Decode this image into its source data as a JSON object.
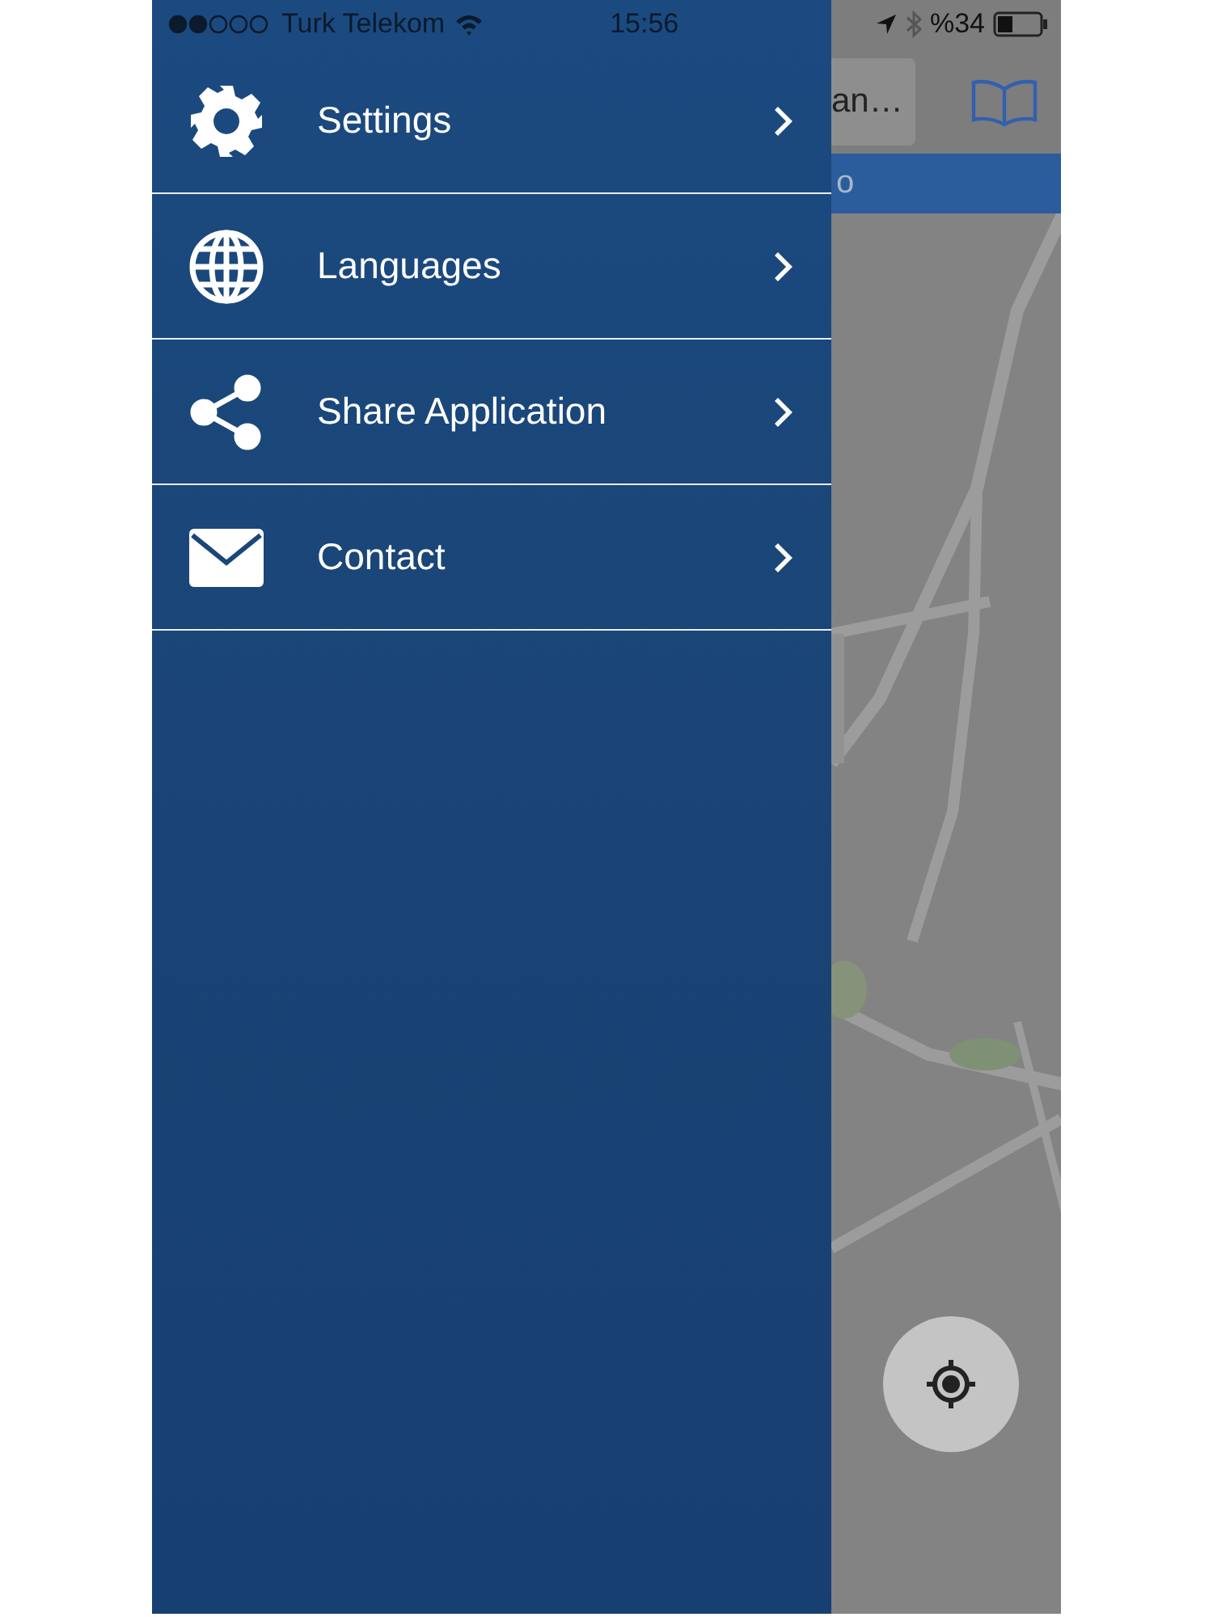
{
  "status_bar": {
    "carrier": "Turk Telekom",
    "time": "15:56",
    "battery": "%34"
  },
  "header": {
    "search_text": "an…",
    "tab_text": "o"
  },
  "menu": [
    {
      "label": "Settings",
      "kind": "settings"
    },
    {
      "label": "Languages",
      "kind": "languages"
    },
    {
      "label": "Share Application",
      "kind": "share"
    },
    {
      "label": "Contact",
      "kind": "contact"
    }
  ]
}
